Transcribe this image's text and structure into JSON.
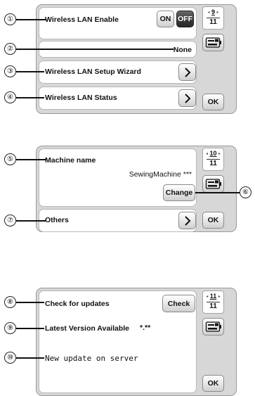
{
  "screen1": {
    "wireless_enable_label": "Wireless LAN Enable",
    "on_label": "ON",
    "off_label": "OFF",
    "selected": "OFF",
    "page_current": "9",
    "page_total": "11",
    "ssid_value": "None",
    "setup_wizard_label": "Wireless LAN Setup Wizard",
    "status_label": "Wireless LAN Status",
    "ok_label": "OK"
  },
  "screen2": {
    "machine_name_label": "Machine name",
    "machine_name_value": "SewingMachine ***",
    "change_label": "Change",
    "others_label": "Others",
    "page_current": "10",
    "page_total": "11",
    "ok_label": "OK"
  },
  "screen3": {
    "check_updates_label": "Check for updates",
    "check_button_label": "Check",
    "latest_version_label": "Latest Version Available",
    "latest_version_value": "*.**",
    "new_update_text": "New update on server",
    "page_current": "11",
    "page_total": "11",
    "ok_label": "OK"
  },
  "callouts": [
    "①",
    "②",
    "③",
    "④",
    "⑤",
    "⑥",
    "⑦",
    "⑧",
    "⑨",
    "⑩"
  ],
  "icons": {
    "arrow": "chevron-right-icon",
    "machine": "sewing-machine-icon",
    "page_prev": "◂",
    "page_next": "▸"
  },
  "colors": {
    "panel_bg": "#d7d7d7",
    "row_bg": "#ffffff",
    "selected_toggle": "#3a3a3a"
  }
}
